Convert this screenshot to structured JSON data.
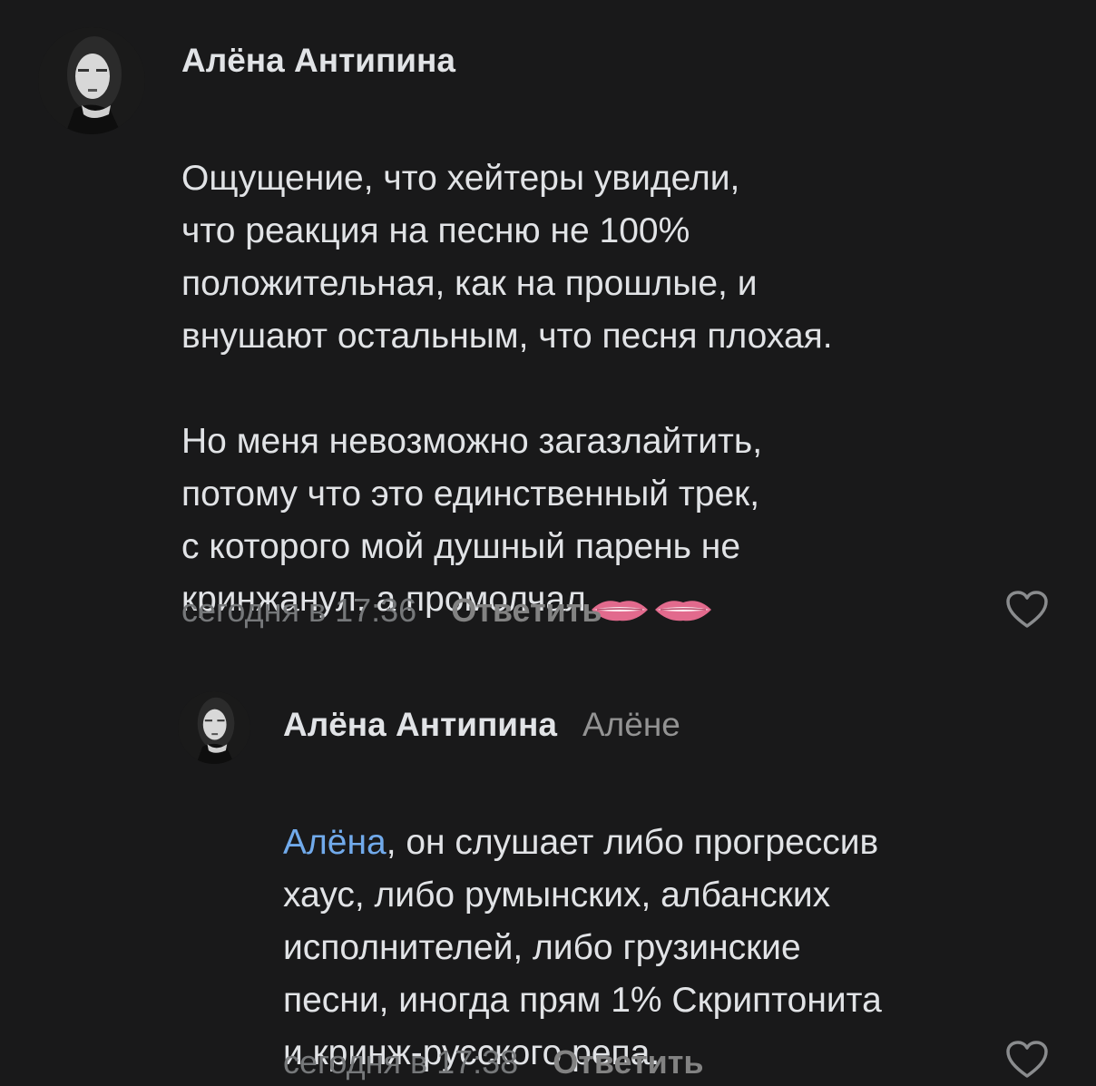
{
  "comments": [
    {
      "author": "Алёна Антипина",
      "text": "Ощущение, что хейтеры увидели,\nчто реакция на песню не 100%\nположительная, как на прошлые, и\nвнушают остальным, что песня плохая.\n\nНо меня невозможно загазлайтить,\nпотому что это единственный трек,\nс которого мой душный парень не\nкринжанул, а промолчал",
      "emoji": [
        "lips-emoji",
        "lips-emoji"
      ],
      "time": "сегодня в 17:36",
      "reply_label": "Ответить"
    },
    {
      "author": "Алёна Антипина",
      "reply_to": "Алёне",
      "mention": "Алёна",
      "text": ", он слушает либо прогрессив\nхаус, либо румынских, албанских\nисполнителей, либо грузинские\nпесни, иногда прям 1% Скриптонита\nи кринж-русского репа.",
      "time": "сегодня в 17:38",
      "reply_label": "Ответить"
    }
  ],
  "colors": {
    "background": "#19191a",
    "text": "#e1e3e6",
    "secondary": "#76787a",
    "mention": "#71aaeb"
  },
  "icons": [
    "heart-outline-icon"
  ]
}
